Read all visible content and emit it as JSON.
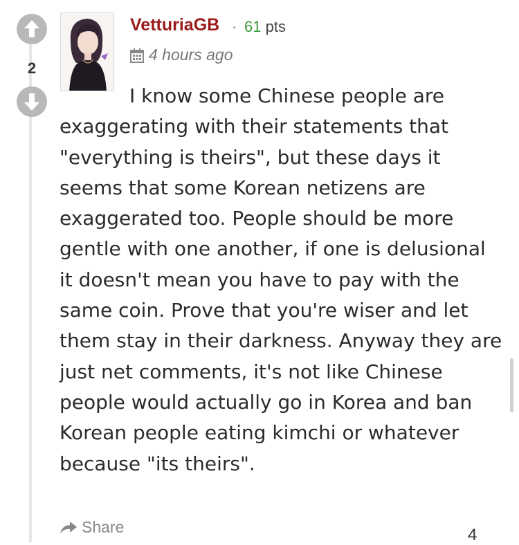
{
  "vote": {
    "score": "2",
    "upvote_icon": "arrow-up-icon",
    "downvote_icon": "arrow-down-icon"
  },
  "comment": {
    "username": "VetturiaGB",
    "separator": "·",
    "points_value": "61",
    "points_label": "pts",
    "timestamp": "4 hours ago",
    "timestamp_icon": "calendar-icon",
    "text": "I know some Chinese people are exaggerating with their statements that \"everything is theirs\", but these days it seems that some Korean netizens are exaggerated too. People should be more gentle with one another, if one is delusional it doesn't mean you have to pay with the same coin. Prove that you're wiser and let them stay in their darkness. Anyway they are just net comments, it's not like Chinese people would actually go in Korea and ban Korean people eating kimchi or whatever because \"its theirs\".",
    "share_label": "Share",
    "share_icon": "share-arrow-icon"
  },
  "next_comment": {
    "score": "4"
  },
  "colors": {
    "username": "#9b1b1b",
    "points": "#3a9a3a",
    "vote_button": "#b8b8b8",
    "thread_line": "#e6e6e6",
    "meta_text": "#777777"
  }
}
